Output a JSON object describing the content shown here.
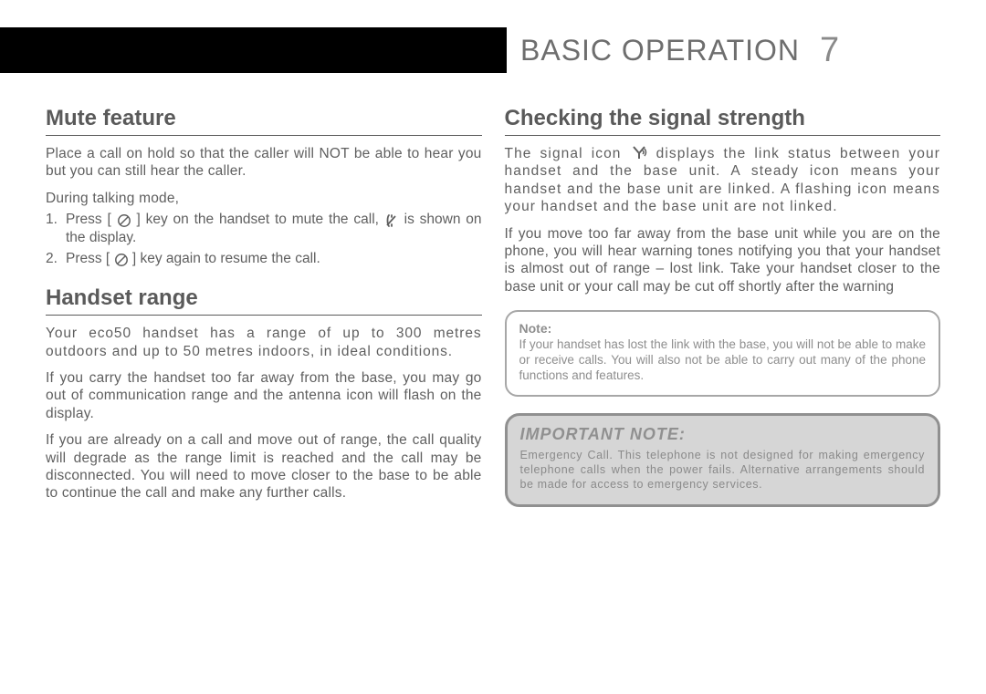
{
  "header": {
    "title": "BASIC OPERATION",
    "page_number": "7"
  },
  "left": {
    "mute": {
      "heading": "Mute feature",
      "intro": "Place a call on hold so that the caller will NOT be able to hear you but you can still hear the caller.",
      "during": "During talking mode,",
      "step1_pre": "Press [",
      "step1_post": "] key on the handset to mute the call,",
      "step1_tail": "is shown on the display.",
      "step2_pre": "Press [",
      "step2_post": "] key again to resume the call."
    },
    "range": {
      "heading": "Handset range",
      "p1": "Your eco50 handset has a range of up to 300 metres outdoors and up to 50 metres indoors, in ideal conditions.",
      "p2": "If you carry the handset too far away from the base, you may go out of communication range and the antenna icon will flash on the display.",
      "p3": "If you are already on a call and move out of range, the call quality will degrade as the range limit is reached and the call may be disconnected. You will need to move closer to the base to be able to continue the call and make any further calls."
    }
  },
  "right": {
    "signal": {
      "heading": "Checking the signal strength",
      "p1_pre": "The signal icon",
      "p1_post": "displays the link status between your handset and the base unit. A steady icon means your handset and the base unit are linked. A flashing icon means your handset and the base unit are not linked.",
      "p2": "If you move too far away from the base unit while you are on the phone, you will hear warning tones notifying you that your handset is almost out of range – lost link. Take your handset closer to the base unit or your call may be cut off shortly after the warning"
    },
    "note": {
      "title": "Note:",
      "body": "If your handset has lost the link with the base, you will not be able to make or receive calls. You will also not be able to carry out many of the phone functions and features."
    },
    "important": {
      "title": "IMPORTANT NOTE:",
      "body": "Emergency Call. This telephone is not designed for making emergency telephone calls when the power fails. Alternative arrangements should be made for access to emergency services."
    }
  }
}
